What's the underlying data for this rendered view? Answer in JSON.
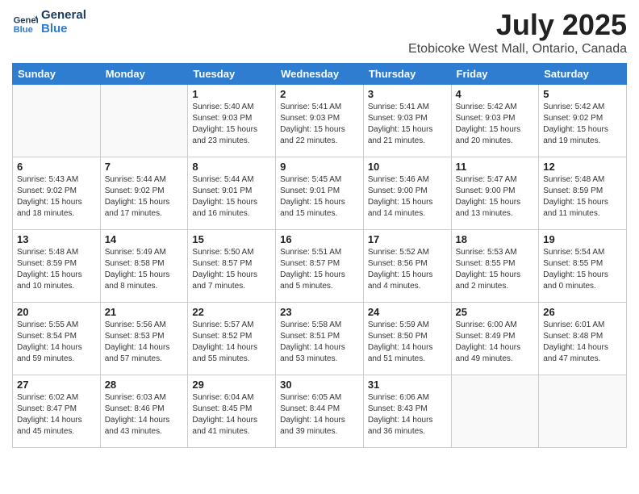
{
  "header": {
    "logo_line1": "General",
    "logo_line2": "Blue",
    "month": "July 2025",
    "location": "Etobicoke West Mall, Ontario, Canada"
  },
  "weekdays": [
    "Sunday",
    "Monday",
    "Tuesday",
    "Wednesday",
    "Thursday",
    "Friday",
    "Saturday"
  ],
  "weeks": [
    [
      {
        "day": "",
        "info": ""
      },
      {
        "day": "",
        "info": ""
      },
      {
        "day": "1",
        "info": "Sunrise: 5:40 AM\nSunset: 9:03 PM\nDaylight: 15 hours\nand 23 minutes."
      },
      {
        "day": "2",
        "info": "Sunrise: 5:41 AM\nSunset: 9:03 PM\nDaylight: 15 hours\nand 22 minutes."
      },
      {
        "day": "3",
        "info": "Sunrise: 5:41 AM\nSunset: 9:03 PM\nDaylight: 15 hours\nand 21 minutes."
      },
      {
        "day": "4",
        "info": "Sunrise: 5:42 AM\nSunset: 9:03 PM\nDaylight: 15 hours\nand 20 minutes."
      },
      {
        "day": "5",
        "info": "Sunrise: 5:42 AM\nSunset: 9:02 PM\nDaylight: 15 hours\nand 19 minutes."
      }
    ],
    [
      {
        "day": "6",
        "info": "Sunrise: 5:43 AM\nSunset: 9:02 PM\nDaylight: 15 hours\nand 18 minutes."
      },
      {
        "day": "7",
        "info": "Sunrise: 5:44 AM\nSunset: 9:02 PM\nDaylight: 15 hours\nand 17 minutes."
      },
      {
        "day": "8",
        "info": "Sunrise: 5:44 AM\nSunset: 9:01 PM\nDaylight: 15 hours\nand 16 minutes."
      },
      {
        "day": "9",
        "info": "Sunrise: 5:45 AM\nSunset: 9:01 PM\nDaylight: 15 hours\nand 15 minutes."
      },
      {
        "day": "10",
        "info": "Sunrise: 5:46 AM\nSunset: 9:00 PM\nDaylight: 15 hours\nand 14 minutes."
      },
      {
        "day": "11",
        "info": "Sunrise: 5:47 AM\nSunset: 9:00 PM\nDaylight: 15 hours\nand 13 minutes."
      },
      {
        "day": "12",
        "info": "Sunrise: 5:48 AM\nSunset: 8:59 PM\nDaylight: 15 hours\nand 11 minutes."
      }
    ],
    [
      {
        "day": "13",
        "info": "Sunrise: 5:48 AM\nSunset: 8:59 PM\nDaylight: 15 hours\nand 10 minutes."
      },
      {
        "day": "14",
        "info": "Sunrise: 5:49 AM\nSunset: 8:58 PM\nDaylight: 15 hours\nand 8 minutes."
      },
      {
        "day": "15",
        "info": "Sunrise: 5:50 AM\nSunset: 8:57 PM\nDaylight: 15 hours\nand 7 minutes."
      },
      {
        "day": "16",
        "info": "Sunrise: 5:51 AM\nSunset: 8:57 PM\nDaylight: 15 hours\nand 5 minutes."
      },
      {
        "day": "17",
        "info": "Sunrise: 5:52 AM\nSunset: 8:56 PM\nDaylight: 15 hours\nand 4 minutes."
      },
      {
        "day": "18",
        "info": "Sunrise: 5:53 AM\nSunset: 8:55 PM\nDaylight: 15 hours\nand 2 minutes."
      },
      {
        "day": "19",
        "info": "Sunrise: 5:54 AM\nSunset: 8:55 PM\nDaylight: 15 hours\nand 0 minutes."
      }
    ],
    [
      {
        "day": "20",
        "info": "Sunrise: 5:55 AM\nSunset: 8:54 PM\nDaylight: 14 hours\nand 59 minutes."
      },
      {
        "day": "21",
        "info": "Sunrise: 5:56 AM\nSunset: 8:53 PM\nDaylight: 14 hours\nand 57 minutes."
      },
      {
        "day": "22",
        "info": "Sunrise: 5:57 AM\nSunset: 8:52 PM\nDaylight: 14 hours\nand 55 minutes."
      },
      {
        "day": "23",
        "info": "Sunrise: 5:58 AM\nSunset: 8:51 PM\nDaylight: 14 hours\nand 53 minutes."
      },
      {
        "day": "24",
        "info": "Sunrise: 5:59 AM\nSunset: 8:50 PM\nDaylight: 14 hours\nand 51 minutes."
      },
      {
        "day": "25",
        "info": "Sunrise: 6:00 AM\nSunset: 8:49 PM\nDaylight: 14 hours\nand 49 minutes."
      },
      {
        "day": "26",
        "info": "Sunrise: 6:01 AM\nSunset: 8:48 PM\nDaylight: 14 hours\nand 47 minutes."
      }
    ],
    [
      {
        "day": "27",
        "info": "Sunrise: 6:02 AM\nSunset: 8:47 PM\nDaylight: 14 hours\nand 45 minutes."
      },
      {
        "day": "28",
        "info": "Sunrise: 6:03 AM\nSunset: 8:46 PM\nDaylight: 14 hours\nand 43 minutes."
      },
      {
        "day": "29",
        "info": "Sunrise: 6:04 AM\nSunset: 8:45 PM\nDaylight: 14 hours\nand 41 minutes."
      },
      {
        "day": "30",
        "info": "Sunrise: 6:05 AM\nSunset: 8:44 PM\nDaylight: 14 hours\nand 39 minutes."
      },
      {
        "day": "31",
        "info": "Sunrise: 6:06 AM\nSunset: 8:43 PM\nDaylight: 14 hours\nand 36 minutes."
      },
      {
        "day": "",
        "info": ""
      },
      {
        "day": "",
        "info": ""
      }
    ]
  ]
}
